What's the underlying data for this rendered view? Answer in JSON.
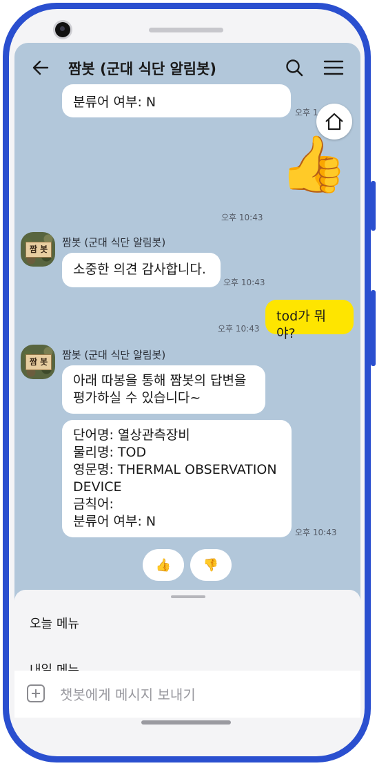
{
  "header": {
    "title": "짬봇 (군대 식단 알림봇)",
    "back_icon": "arrow-left-icon",
    "search_icon": "search-icon",
    "menu_icon": "hamburger-menu-icon"
  },
  "bot": {
    "name": "짬봇 (군대 식단 알림봇)",
    "avatar_label": "짬 봇"
  },
  "messages": {
    "top_partial": {
      "text": "분류어 여부: N",
      "time": "오후 1"
    },
    "thumbs_sticker": {
      "emoji": "👍",
      "time": "오후 10:43"
    },
    "thanks": {
      "text": "소중한 의견 감사합니다.",
      "time": "오후 10:43"
    },
    "question": {
      "text": "tod가 뭐야?",
      "time": "오후 10:43"
    },
    "rate_prompt": {
      "line1": "아래 따봉을 통해 짬봇의 답변을",
      "line2": "평가하실 수 있습니다~"
    },
    "answer": {
      "lines": [
        "단어명: 열상관측장비",
        "물리명: TOD",
        "영문명: THERMAL OBSERVATION",
        "DEVICE",
        "금칙어:",
        "분류어 여부: N"
      ],
      "time": "오후 10:43"
    }
  },
  "reactions": {
    "up": "👍",
    "down": "👎"
  },
  "home_icon": "home-icon",
  "quick_replies": [
    "오늘 메뉴",
    "내일 메뉴"
  ],
  "input": {
    "placeholder": "챗봇에게 메시지 보내기",
    "plus_icon": "plus-icon"
  },
  "colors": {
    "chat_bg": "#b2c7da",
    "my_bubble": "#fee500",
    "bot_bubble": "#ffffff",
    "frame": "#2a4fcf"
  }
}
